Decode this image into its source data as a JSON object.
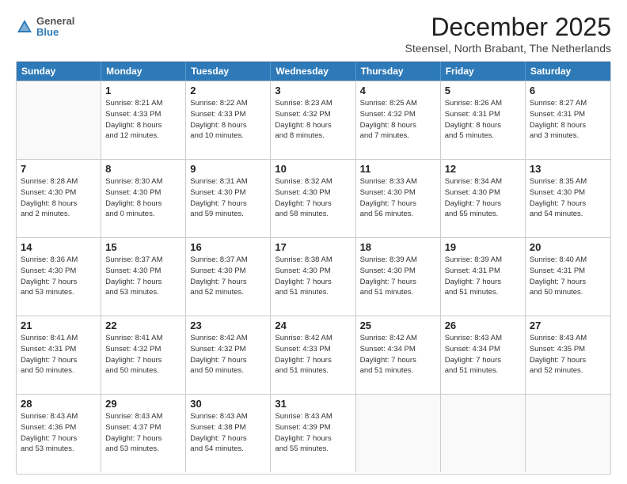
{
  "logo": {
    "line1": "General",
    "line2": "Blue"
  },
  "title": "December 2025",
  "subtitle": "Steensel, North Brabant, The Netherlands",
  "header_days": [
    "Sunday",
    "Monday",
    "Tuesday",
    "Wednesday",
    "Thursday",
    "Friday",
    "Saturday"
  ],
  "weeks": [
    [
      {
        "day": "",
        "info": ""
      },
      {
        "day": "1",
        "info": "Sunrise: 8:21 AM\nSunset: 4:33 PM\nDaylight: 8 hours\nand 12 minutes."
      },
      {
        "day": "2",
        "info": "Sunrise: 8:22 AM\nSunset: 4:33 PM\nDaylight: 8 hours\nand 10 minutes."
      },
      {
        "day": "3",
        "info": "Sunrise: 8:23 AM\nSunset: 4:32 PM\nDaylight: 8 hours\nand 8 minutes."
      },
      {
        "day": "4",
        "info": "Sunrise: 8:25 AM\nSunset: 4:32 PM\nDaylight: 8 hours\nand 7 minutes."
      },
      {
        "day": "5",
        "info": "Sunrise: 8:26 AM\nSunset: 4:31 PM\nDaylight: 8 hours\nand 5 minutes."
      },
      {
        "day": "6",
        "info": "Sunrise: 8:27 AM\nSunset: 4:31 PM\nDaylight: 8 hours\nand 3 minutes."
      }
    ],
    [
      {
        "day": "7",
        "info": "Sunrise: 8:28 AM\nSunset: 4:30 PM\nDaylight: 8 hours\nand 2 minutes."
      },
      {
        "day": "8",
        "info": "Sunrise: 8:30 AM\nSunset: 4:30 PM\nDaylight: 8 hours\nand 0 minutes."
      },
      {
        "day": "9",
        "info": "Sunrise: 8:31 AM\nSunset: 4:30 PM\nDaylight: 7 hours\nand 59 minutes."
      },
      {
        "day": "10",
        "info": "Sunrise: 8:32 AM\nSunset: 4:30 PM\nDaylight: 7 hours\nand 58 minutes."
      },
      {
        "day": "11",
        "info": "Sunrise: 8:33 AM\nSunset: 4:30 PM\nDaylight: 7 hours\nand 56 minutes."
      },
      {
        "day": "12",
        "info": "Sunrise: 8:34 AM\nSunset: 4:30 PM\nDaylight: 7 hours\nand 55 minutes."
      },
      {
        "day": "13",
        "info": "Sunrise: 8:35 AM\nSunset: 4:30 PM\nDaylight: 7 hours\nand 54 minutes."
      }
    ],
    [
      {
        "day": "14",
        "info": "Sunrise: 8:36 AM\nSunset: 4:30 PM\nDaylight: 7 hours\nand 53 minutes."
      },
      {
        "day": "15",
        "info": "Sunrise: 8:37 AM\nSunset: 4:30 PM\nDaylight: 7 hours\nand 53 minutes."
      },
      {
        "day": "16",
        "info": "Sunrise: 8:37 AM\nSunset: 4:30 PM\nDaylight: 7 hours\nand 52 minutes."
      },
      {
        "day": "17",
        "info": "Sunrise: 8:38 AM\nSunset: 4:30 PM\nDaylight: 7 hours\nand 51 minutes."
      },
      {
        "day": "18",
        "info": "Sunrise: 8:39 AM\nSunset: 4:30 PM\nDaylight: 7 hours\nand 51 minutes."
      },
      {
        "day": "19",
        "info": "Sunrise: 8:39 AM\nSunset: 4:31 PM\nDaylight: 7 hours\nand 51 minutes."
      },
      {
        "day": "20",
        "info": "Sunrise: 8:40 AM\nSunset: 4:31 PM\nDaylight: 7 hours\nand 50 minutes."
      }
    ],
    [
      {
        "day": "21",
        "info": "Sunrise: 8:41 AM\nSunset: 4:31 PM\nDaylight: 7 hours\nand 50 minutes."
      },
      {
        "day": "22",
        "info": "Sunrise: 8:41 AM\nSunset: 4:32 PM\nDaylight: 7 hours\nand 50 minutes."
      },
      {
        "day": "23",
        "info": "Sunrise: 8:42 AM\nSunset: 4:32 PM\nDaylight: 7 hours\nand 50 minutes."
      },
      {
        "day": "24",
        "info": "Sunrise: 8:42 AM\nSunset: 4:33 PM\nDaylight: 7 hours\nand 51 minutes."
      },
      {
        "day": "25",
        "info": "Sunrise: 8:42 AM\nSunset: 4:34 PM\nDaylight: 7 hours\nand 51 minutes."
      },
      {
        "day": "26",
        "info": "Sunrise: 8:43 AM\nSunset: 4:34 PM\nDaylight: 7 hours\nand 51 minutes."
      },
      {
        "day": "27",
        "info": "Sunrise: 8:43 AM\nSunset: 4:35 PM\nDaylight: 7 hours\nand 52 minutes."
      }
    ],
    [
      {
        "day": "28",
        "info": "Sunrise: 8:43 AM\nSunset: 4:36 PM\nDaylight: 7 hours\nand 53 minutes."
      },
      {
        "day": "29",
        "info": "Sunrise: 8:43 AM\nSunset: 4:37 PM\nDaylight: 7 hours\nand 53 minutes."
      },
      {
        "day": "30",
        "info": "Sunrise: 8:43 AM\nSunset: 4:38 PM\nDaylight: 7 hours\nand 54 minutes."
      },
      {
        "day": "31",
        "info": "Sunrise: 8:43 AM\nSunset: 4:39 PM\nDaylight: 7 hours\nand 55 minutes."
      },
      {
        "day": "",
        "info": ""
      },
      {
        "day": "",
        "info": ""
      },
      {
        "day": "",
        "info": ""
      }
    ]
  ]
}
